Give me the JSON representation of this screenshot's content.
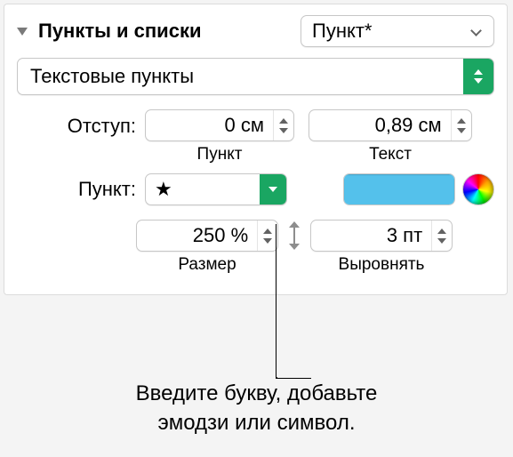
{
  "header": {
    "title": "Пункты и списки",
    "style_value": "Пункт*"
  },
  "bullet_type": {
    "value": "Текстовые пункты"
  },
  "indent": {
    "label": "Отступ:",
    "bullet": {
      "value": "0 см",
      "caption": "Пункт"
    },
    "text": {
      "value": "0,89 см",
      "caption": "Текст"
    }
  },
  "bullet": {
    "label": "Пункт:",
    "glyph": "★",
    "color": "#54c1eb"
  },
  "size": {
    "value": "250 %",
    "caption": "Размер"
  },
  "align": {
    "value": "3 пт",
    "caption": "Выровнять"
  },
  "callout": {
    "line1": "Введите букву, добавьте",
    "line2": "эмодзи или символ."
  }
}
